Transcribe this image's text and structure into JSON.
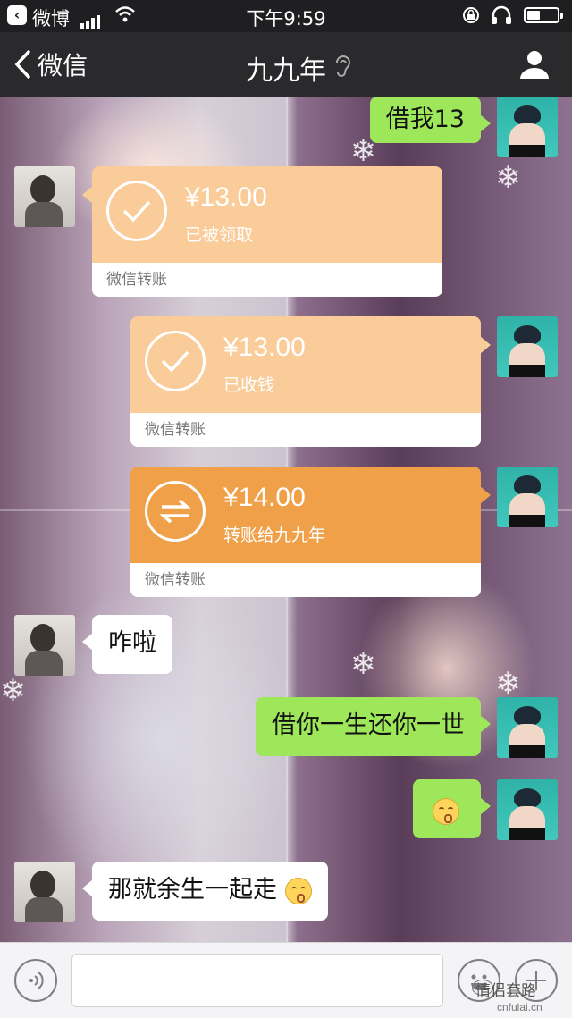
{
  "status_bar": {
    "app_label": "微博",
    "time": "下午9:59",
    "battery_level": 0.45
  },
  "nav": {
    "back_label": "微信",
    "title": "九九年"
  },
  "messages": [
    {
      "type": "text",
      "side": "right",
      "text": "借我13"
    },
    {
      "type": "transfer",
      "side": "left",
      "status": "received",
      "amount": "¥13.00",
      "note": "已被领取",
      "footer": "微信转账"
    },
    {
      "type": "transfer",
      "side": "right",
      "status": "received",
      "amount": "¥13.00",
      "note": "已收钱",
      "footer": "微信转账"
    },
    {
      "type": "transfer",
      "side": "right",
      "status": "pending",
      "amount": "¥14.00",
      "note": "转账给九九年",
      "footer": "微信转账"
    },
    {
      "type": "text",
      "side": "left",
      "text": "咋啦"
    },
    {
      "type": "text",
      "side": "right",
      "text": "借你一生还你一世"
    },
    {
      "type": "emoji",
      "side": "right",
      "emoji": "kissing-face"
    },
    {
      "type": "text",
      "side": "left",
      "text": "那就余生一起走",
      "emoji": "kissing-face"
    }
  ],
  "watermark": {
    "label": "情侣套路",
    "site": "cnfulai.cn"
  },
  "colors": {
    "self_bubble": "#9ee75b",
    "transfer_received": "#f9cc99",
    "transfer_pending": "#f0a049"
  }
}
